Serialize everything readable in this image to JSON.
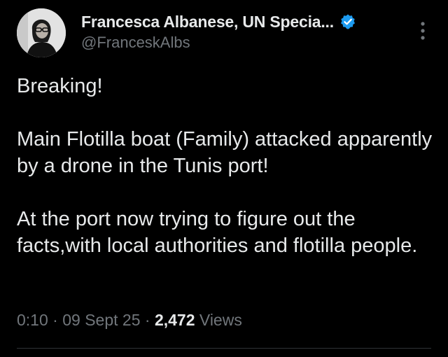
{
  "author": {
    "display_name": "Francesca Albanese, UN Specia...",
    "handle": "@FranceskAlbs",
    "verified_icon": "verified-badge-icon",
    "verified_color": "#1d9bf0"
  },
  "post": {
    "text": "Breaking!\n\nMain Flotilla boat (Family) attacked apparently by a drone in the Tunis port!\n\nAt the port now trying to figure out the facts,with local authorities and flotilla people."
  },
  "meta": {
    "time": "0:10",
    "separator": " · ",
    "date": "09 Sept 25",
    "views_count": "2,472",
    "views_label": " Views"
  },
  "colors": {
    "background": "#000000",
    "text_primary": "#e7e9ea",
    "text_secondary": "#71767b",
    "divider": "#2f3336"
  }
}
